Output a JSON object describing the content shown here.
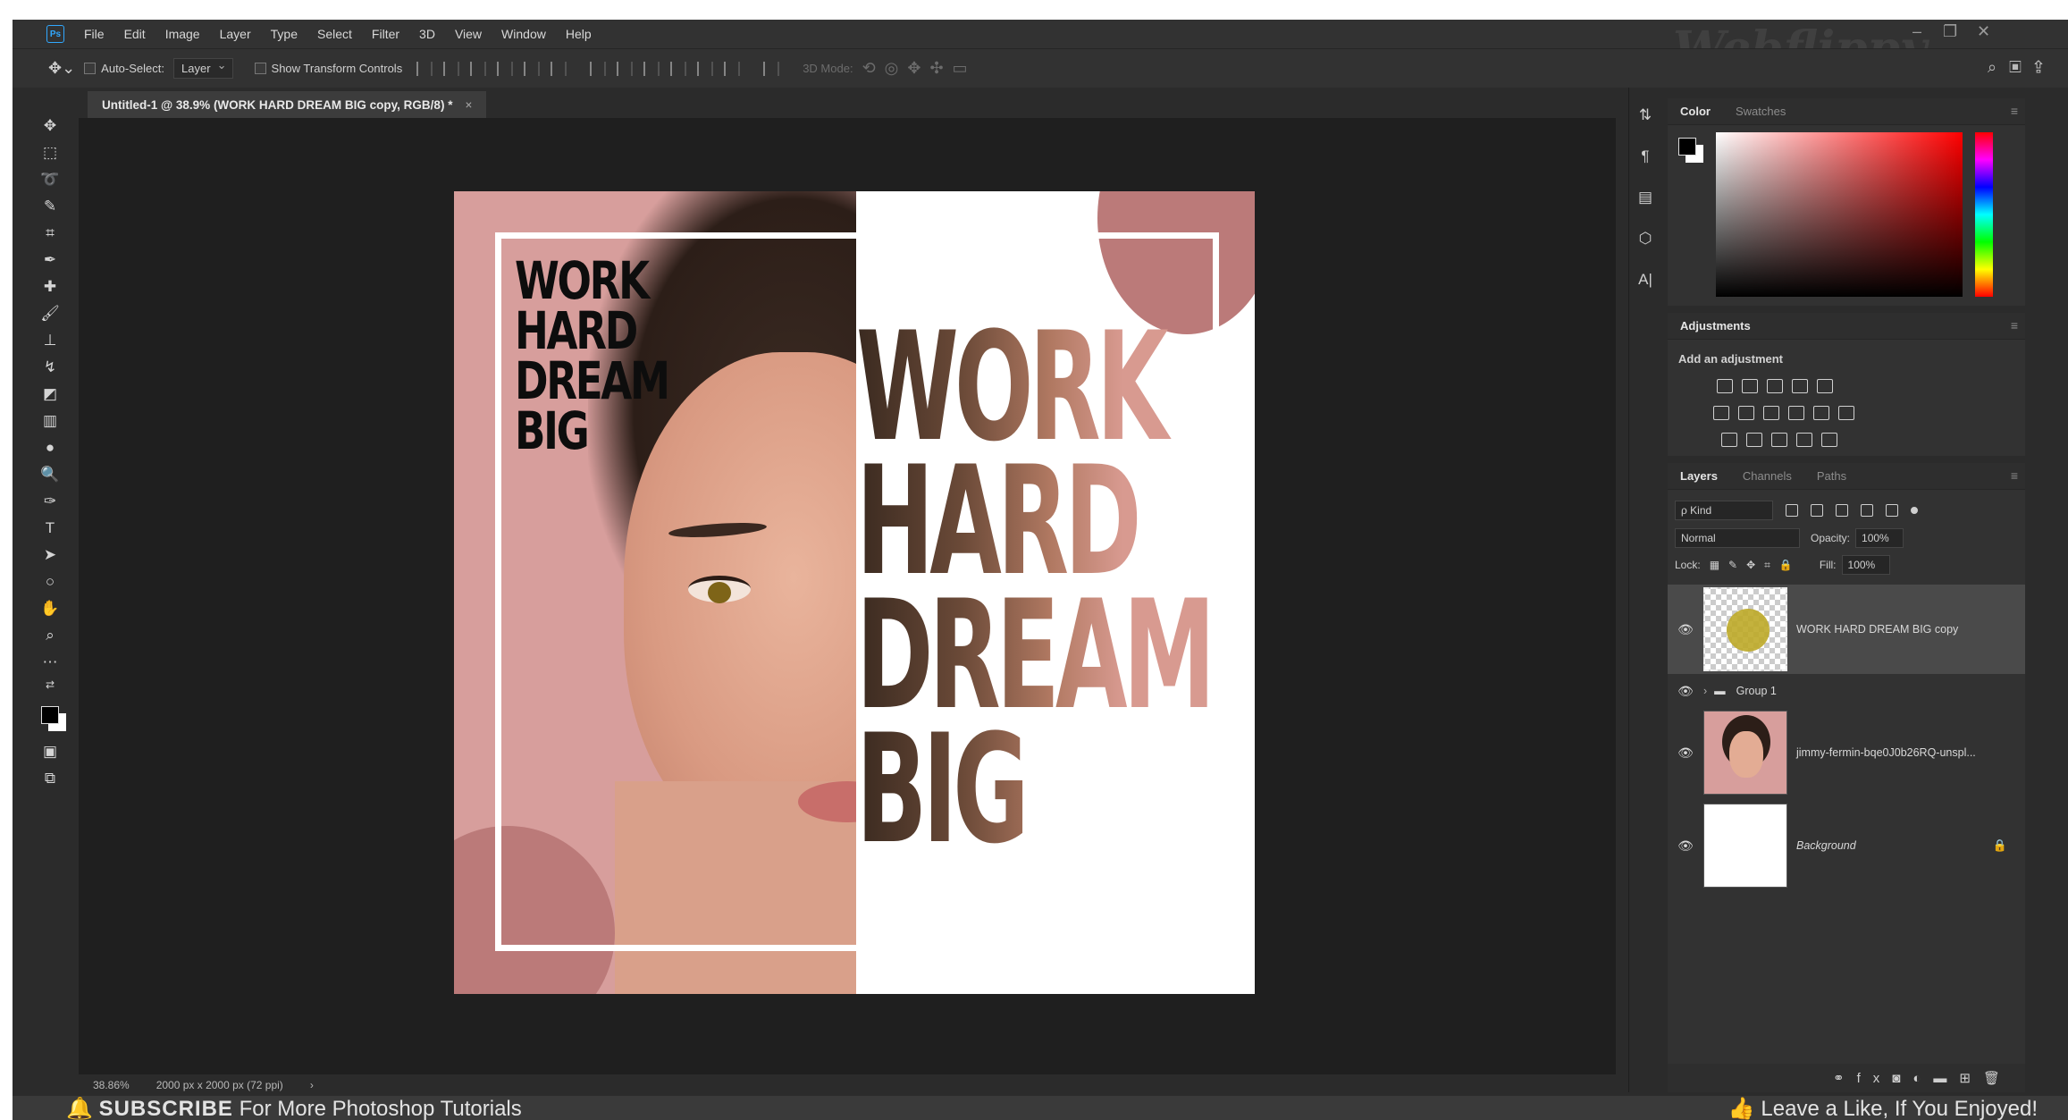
{
  "menu": {
    "items": [
      "File",
      "Edit",
      "Image",
      "Layer",
      "Type",
      "Select",
      "Filter",
      "3D",
      "View",
      "Window",
      "Help"
    ],
    "logo": "Ps",
    "watermark": "Webflippy"
  },
  "options": {
    "auto_select_label": "Auto-Select:",
    "auto_select_value": "Layer",
    "transform_label": "Show Transform Controls",
    "mode_label": "3D Mode:"
  },
  "document": {
    "tab_title": "Untitled-1 @ 38.9% (WORK HARD DREAM BIG copy, RGB/8) *",
    "close": "×"
  },
  "artwork": {
    "small_lines": [
      "WORK",
      "HARD",
      "DREAM",
      "BIG"
    ],
    "big_lines": [
      "WORK",
      "HARD",
      "DREAM",
      "BIG"
    ]
  },
  "color_panel": {
    "tabs": [
      "Color",
      "Swatches"
    ]
  },
  "adjustments": {
    "title": "Adjustments",
    "subtitle": "Add an adjustment"
  },
  "layers_panel": {
    "tabs": [
      "Layers",
      "Channels",
      "Paths"
    ],
    "kind": "ρ Kind",
    "blend_mode": "Normal",
    "opacity_label": "Opacity:",
    "opacity_value": "100%",
    "lock_label": "Lock:",
    "fill_label": "Fill:",
    "fill_value": "100%",
    "layers": [
      {
        "name": "WORK HARD DREAM BIG copy"
      },
      {
        "name": "Group 1"
      },
      {
        "name": "jimmy-fermin-bqe0J0b26RQ-unspl..."
      },
      {
        "name": "Background"
      }
    ]
  },
  "status": {
    "zoom": "38.86%",
    "doc_size": "2000 px x 2000 px (72 ppi)",
    "arrow": "›"
  },
  "footer": {
    "subscribe_bold": "SUBSCRIBE",
    "subscribe_rest": "For More Photoshop Tutorials",
    "like": "Leave a Like, If You Enjoyed!"
  }
}
